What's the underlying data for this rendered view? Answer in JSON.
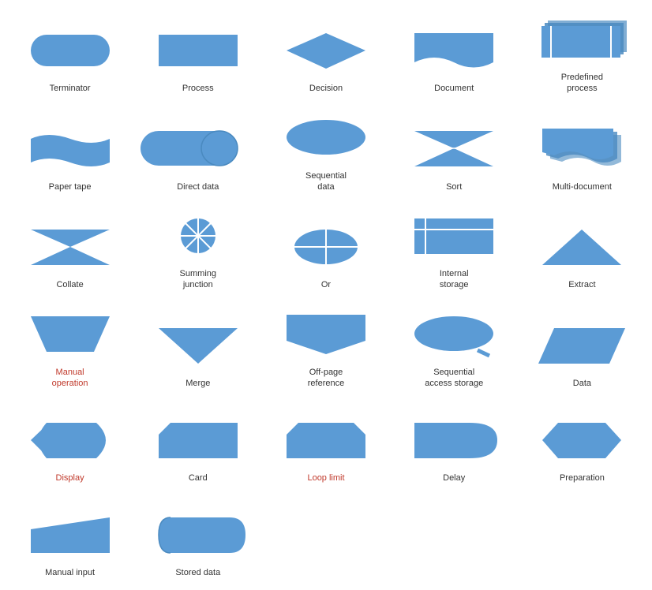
{
  "shapes": [
    {
      "id": "terminator",
      "label": "Terminator",
      "red": false
    },
    {
      "id": "process",
      "label": "Process",
      "red": false
    },
    {
      "id": "decision",
      "label": "Decision",
      "red": false
    },
    {
      "id": "document",
      "label": "Document",
      "red": false
    },
    {
      "id": "predefined-process",
      "label": "Predefined\nprocess",
      "red": false
    },
    {
      "id": "paper-tape",
      "label": "Paper tape",
      "red": false
    },
    {
      "id": "direct-data",
      "label": "Direct data",
      "red": false
    },
    {
      "id": "sequential-data",
      "label": "Sequential\ndata",
      "red": false
    },
    {
      "id": "sort",
      "label": "Sort",
      "red": false
    },
    {
      "id": "multi-document",
      "label": "Multi-document",
      "red": false
    },
    {
      "id": "collate",
      "label": "Collate",
      "red": false
    },
    {
      "id": "summing-junction",
      "label": "Summing\njunction",
      "red": false
    },
    {
      "id": "or",
      "label": "Or",
      "red": false
    },
    {
      "id": "internal-storage",
      "label": "Internal\nstorage",
      "red": false
    },
    {
      "id": "extract",
      "label": "Extract",
      "red": false
    },
    {
      "id": "manual-operation",
      "label": "Manual\noperation",
      "red": true
    },
    {
      "id": "merge",
      "label": "Merge",
      "red": false
    },
    {
      "id": "off-page-reference",
      "label": "Off-page\nreference",
      "red": false
    },
    {
      "id": "sequential-access-storage",
      "label": "Sequential\naccess storage",
      "red": false
    },
    {
      "id": "data",
      "label": "Data",
      "red": false
    },
    {
      "id": "display",
      "label": "Display",
      "red": true
    },
    {
      "id": "card",
      "label": "Card",
      "red": false
    },
    {
      "id": "loop-limit",
      "label": "Loop limit",
      "red": true
    },
    {
      "id": "delay",
      "label": "Delay",
      "red": false
    },
    {
      "id": "preparation",
      "label": "Preparation",
      "red": false
    },
    {
      "id": "manual-input",
      "label": "Manual input",
      "red": false
    },
    {
      "id": "stored-data",
      "label": "Stored data",
      "red": false
    }
  ],
  "color": "#5b9bd5"
}
